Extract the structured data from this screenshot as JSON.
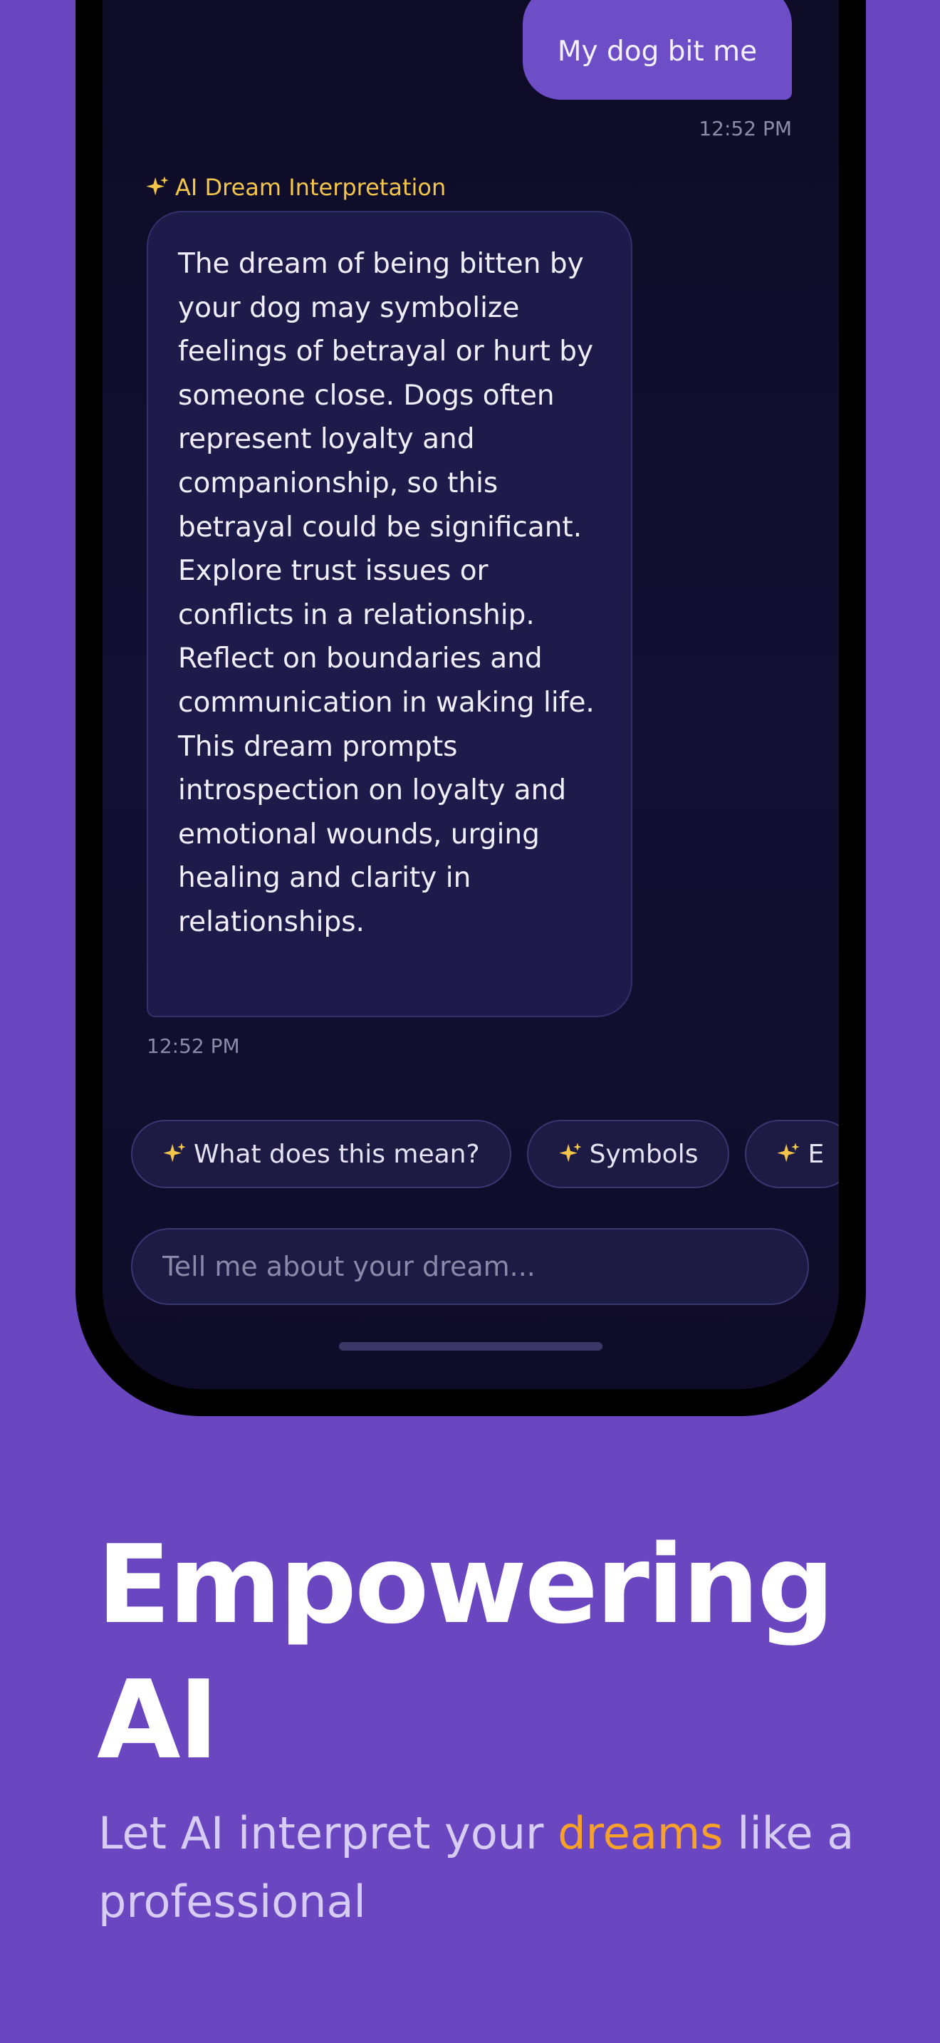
{
  "chat": {
    "user_message": "My dog bit me",
    "user_time": "12:52 PM",
    "ai_label": "AI Dream Interpretation",
    "ai_response": "The dream of being bitten by your dog may symbolize feelings of betrayal or hurt by someone close. Dogs often represent loyalty and companionship, so this betrayal could be significant. Explore trust issues or conflicts in a relationship. Reflect on boundaries and communication in waking life. This dream prompts introspection on loyalty and emotional wounds, urging healing and clarity in relationships.",
    "ai_time": "12:52 PM"
  },
  "suggestions": [
    {
      "label": "What does this mean?"
    },
    {
      "label": "Symbols"
    },
    {
      "label": "E"
    }
  ],
  "input": {
    "placeholder": "Tell me about your dream..."
  },
  "promo": {
    "headline_line1": "Empowering",
    "headline_line2": "AI",
    "sub_before": "Let AI interpret your ",
    "sub_highlight": "dreams",
    "sub_after": " like a professional"
  },
  "colors": {
    "background": "#6a46c1",
    "user_bubble": "#6d4ec7",
    "ai_bubble": "#1e1b4a",
    "accent_gold": "#f3c64b",
    "highlight_orange": "#f7a12a"
  },
  "icons": {
    "sparkle": "sparkles-icon"
  }
}
